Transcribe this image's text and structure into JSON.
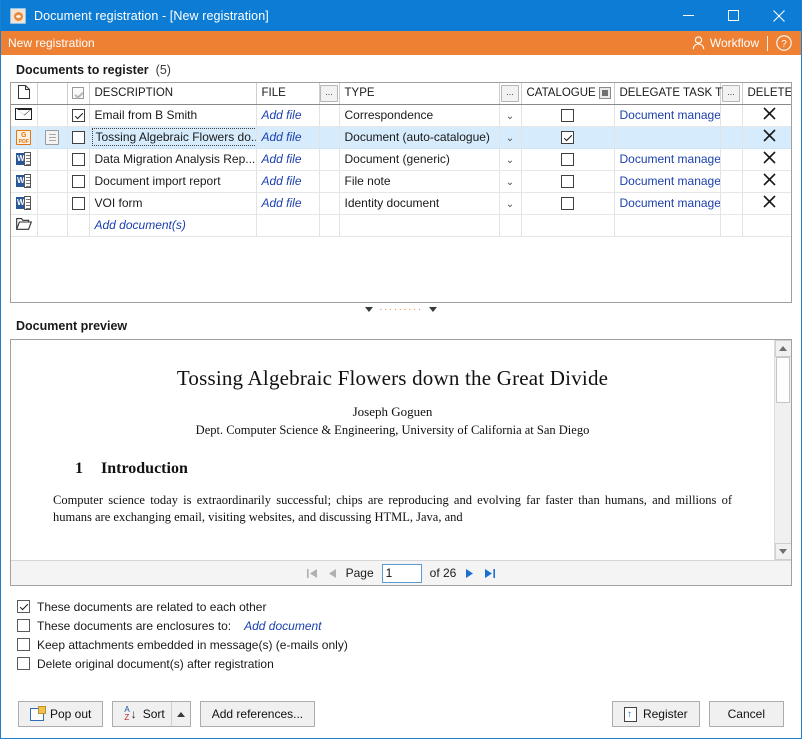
{
  "window": {
    "title": "Document registration - [New registration]",
    "app_icon": "app-icon",
    "minimize": "minimize-icon",
    "maximize": "maximize-icon",
    "close": "close-icon"
  },
  "workflow_bar": {
    "left_label": "New registration",
    "workflow_label": "Workflow",
    "person_icon": "person-icon",
    "help_icon": "help-icon",
    "background": "#ee8034"
  },
  "documents_section": {
    "title": "Documents to register",
    "count": "(5)",
    "columns": {
      "doc_icon": "document-icon",
      "preview_icon": "",
      "select_all": "select-all-checkbox",
      "description": "DESCRIPTION",
      "file": "FILE",
      "file_menu": "...",
      "type": "TYPE",
      "type_menu": "...",
      "catalogue": "CATALOGUE",
      "catalogue_menu": "catalogue-options",
      "delegate": "DELEGATE TASK TO",
      "delegate_menu": "...",
      "delete": "DELETE"
    },
    "rows": [
      {
        "file_icon": "email-icon",
        "secondary_icon": "",
        "checked": true,
        "description": "Email from B Smith",
        "file": "Add file",
        "type": "Correspondence",
        "catalogue": false,
        "delegate": "Document manager",
        "delete": "×",
        "selected": false
      },
      {
        "file_icon": "pdf-icon",
        "secondary_icon": "preview-icon",
        "checked": false,
        "description": "Tossing Algebraic Flowers do...",
        "file": "Add file",
        "type": "Document (auto-catalogue)",
        "catalogue": true,
        "delegate": "",
        "delete": "×",
        "selected": true
      },
      {
        "file_icon": "word-icon",
        "secondary_icon": "",
        "checked": false,
        "description": "Data Migration Analysis Rep...",
        "file": "Add file",
        "type": "Document (generic)",
        "catalogue": false,
        "delegate": "Document manager",
        "delete": "×",
        "selected": false
      },
      {
        "file_icon": "word-icon",
        "secondary_icon": "",
        "checked": false,
        "description": "Document import report",
        "file": "Add file",
        "type": "File note",
        "catalogue": false,
        "delegate": "Document manager",
        "delete": "×",
        "selected": false
      },
      {
        "file_icon": "word-icon",
        "secondary_icon": "",
        "checked": false,
        "description": "VOI form",
        "file": "Add file",
        "type": "Identity document",
        "catalogue": false,
        "delegate": "Document manager",
        "delete": "×",
        "selected": false
      }
    ],
    "add_row": {
      "folder_icon": "folder-open-icon",
      "label": "Add document(s)"
    }
  },
  "splitter": {
    "collapse_up_icon": "triangle-icon",
    "grip": "·········",
    "collapse_down_icon": "triangle-icon",
    "accent": "#ee8034"
  },
  "preview": {
    "title": "Document preview",
    "document": {
      "title": "Tossing Algebraic Flowers down the Great Divide",
      "author": "Joseph Goguen",
      "affiliation": "Dept. Computer Science & Engineering, University of California at San Diego",
      "section_number": "1",
      "section_title": "Introduction",
      "paragraph_1": "Computer science today is extraordinarily successful; chips are reproducing and evolving far faster than humans, and millions of humans are exchanging email, visiting websites, and discussing HTML, Java, and"
    },
    "pager": {
      "first_icon": "first-page-icon",
      "prev_icon": "previous-page-icon",
      "page_label": "Page",
      "page_value": "1",
      "of_label": "of 26",
      "next_icon": "next-page-icon",
      "last_icon": "last-page-icon"
    },
    "scrollbar": {
      "up_icon": "scroll-up-icon",
      "down_icon": "scroll-down-icon"
    }
  },
  "options": [
    {
      "label": "These documents are related to each other",
      "checked": true,
      "link": ""
    },
    {
      "label": "These documents are enclosures to:",
      "checked": false,
      "link": "Add document"
    },
    {
      "label": "Keep attachments embedded in message(s) (e-mails only)",
      "checked": false,
      "link": ""
    },
    {
      "label": "Delete original document(s) after registration",
      "checked": false,
      "link": ""
    }
  ],
  "footer": {
    "pop_out": "Pop out",
    "pop_out_icon": "pop-out-icon",
    "sort": "Sort",
    "sort_icon": "sort-az-icon",
    "sort_arrow": "dropdown-arrow-icon",
    "add_references": "Add references...",
    "register": "Register",
    "register_icon": "register-icon",
    "cancel": "Cancel"
  }
}
